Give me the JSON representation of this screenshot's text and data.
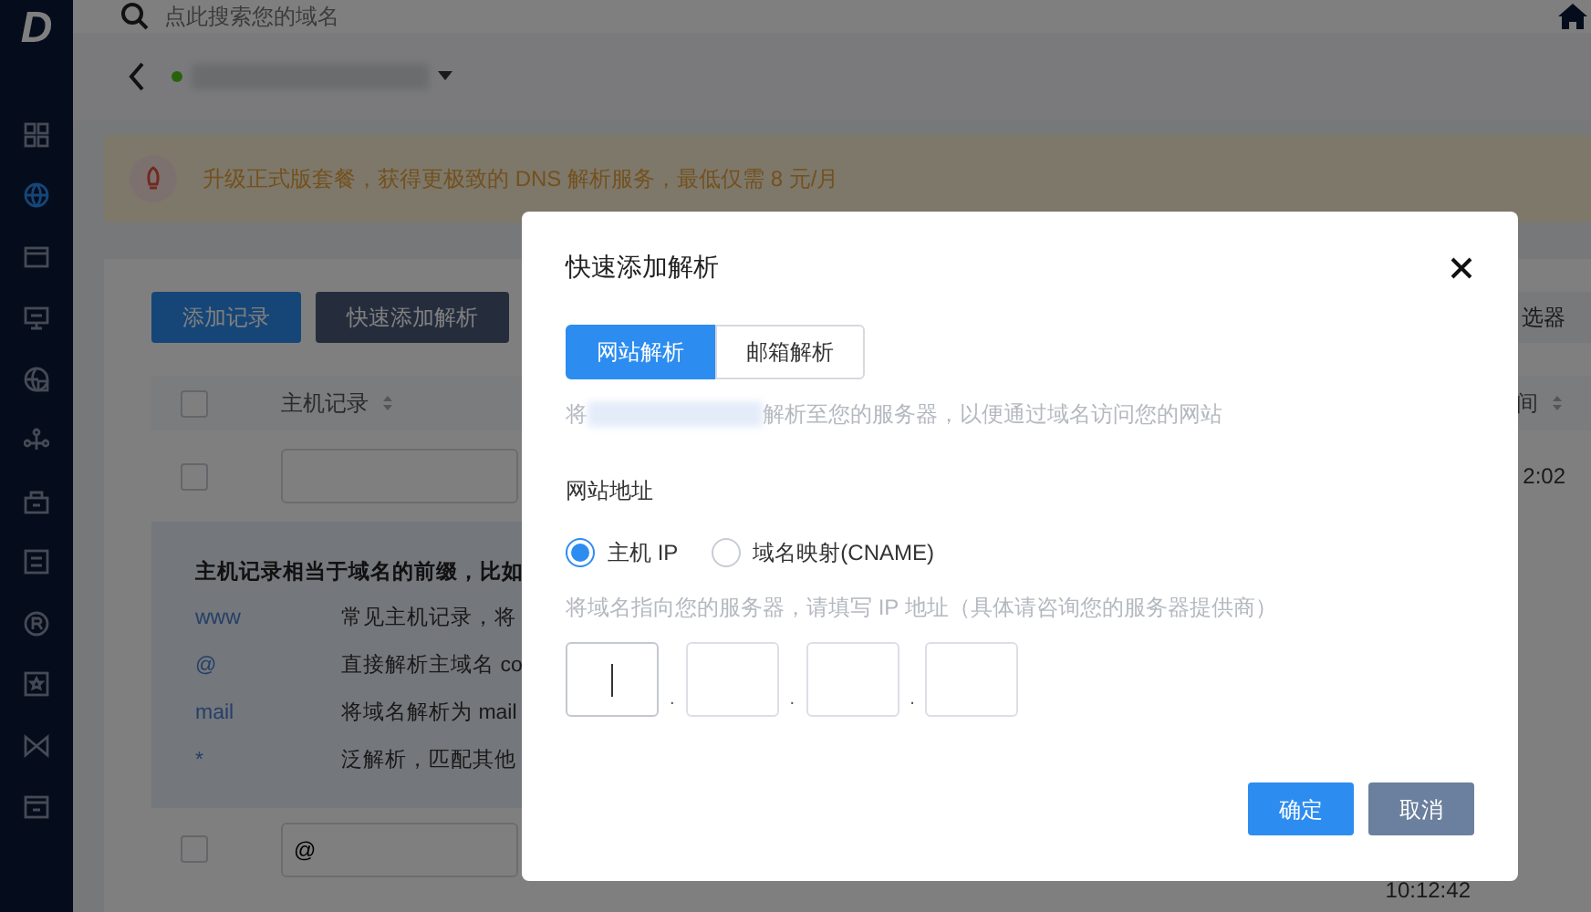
{
  "sidebar": {
    "logo": "D",
    "items": [
      {
        "selected": false
      },
      {
        "selected": true
      },
      {
        "selected": false
      },
      {
        "selected": false
      },
      {
        "selected": false
      },
      {
        "selected": false
      },
      {
        "selected": false
      },
      {
        "selected": false
      },
      {
        "selected": false
      },
      {
        "selected": false
      },
      {
        "selected": false
      },
      {
        "selected": false
      }
    ]
  },
  "search": {
    "placeholder": "点此搜索您的域名"
  },
  "banner": {
    "text": "升级正式版套餐，获得更极致的 DNS 解析服务，最低仅需 8 元/月"
  },
  "toolbar": {
    "buttons": [
      {
        "label": "添加记录",
        "kind": "primary"
      },
      {
        "label": "快速添加解析",
        "kind": "secondary"
      }
    ],
    "filter_button": "选器"
  },
  "table": {
    "select_all_checked": false,
    "columns": [
      {
        "label": "主机记录"
      },
      {
        "label": "间"
      }
    ],
    "rows": [
      {
        "checked": false,
        "time": "2:02"
      },
      {
        "checked": false,
        "host": "@",
        "time": "10:12:42"
      }
    ]
  },
  "tooltip": {
    "title": "主机记录相当于域名的前缀，比如",
    "rows": [
      {
        "key": "www",
        "text": "常见主机记录，将"
      },
      {
        "key": "@",
        "text": "直接解析主域名 co"
      },
      {
        "key": "mail",
        "text": "将域名解析为 mail"
      },
      {
        "key": "*",
        "text": "泛解析，匹配其他"
      }
    ]
  },
  "modal": {
    "title": "快速添加解析",
    "tabs": [
      {
        "label": "网站解析",
        "selected": true
      },
      {
        "label": "邮箱解析",
        "selected": false
      }
    ],
    "description_start": "将",
    "description_end": "解析至您的服务器，以便通过域名访问您的网站",
    "field_label": "网站地址",
    "options": [
      {
        "label": "主机 IP",
        "selected": true
      },
      {
        "label": "域名映射(CNAME)",
        "selected": false
      }
    ],
    "hint": "将域名指向您的服务器，请填写 IP 地址（具体请咨询您的服务器提供商）",
    "octets": [
      {
        "focused": true
      },
      {
        "focused": false
      },
      {
        "focused": false
      },
      {
        "focused": false
      }
    ],
    "separators": [
      ".",
      ".",
      "."
    ],
    "buttons": [
      {
        "label": "确定",
        "kind": "primary"
      },
      {
        "label": "取消",
        "kind": "secondary"
      }
    ]
  }
}
